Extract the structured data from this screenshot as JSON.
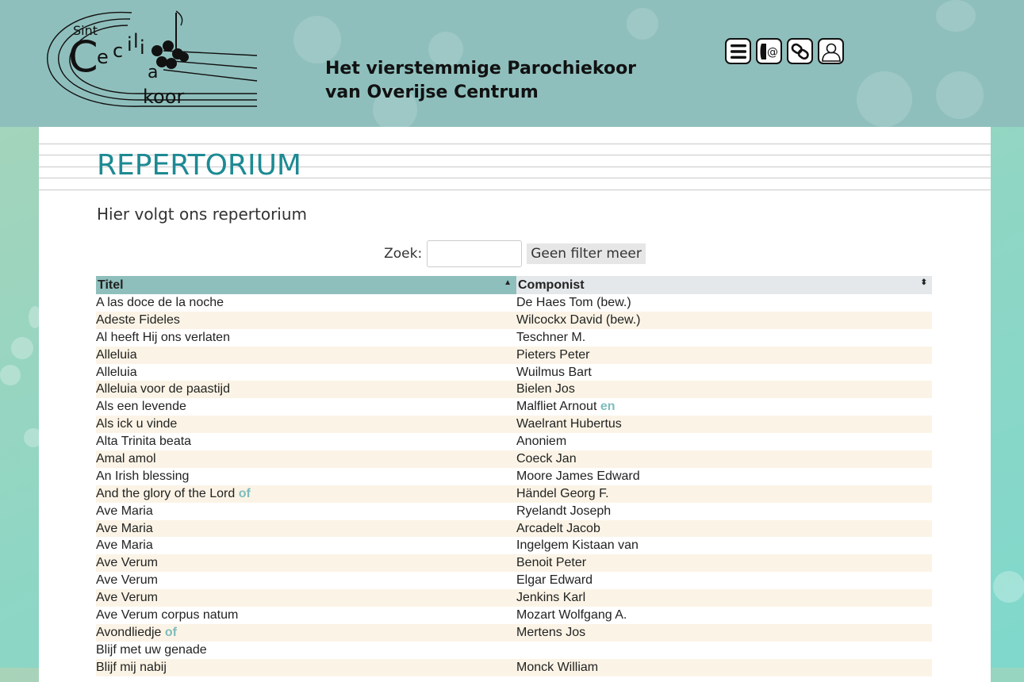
{
  "header": {
    "logo_alt": "Sint Cecilia koor",
    "tagline_line1": "Het vierstemmige Parochiekoor",
    "tagline_line2": "van Overijse Centrum",
    "icons": [
      "menu-icon",
      "contact-icon",
      "link-icon",
      "user-icon"
    ]
  },
  "page": {
    "title": "REPERTORIUM",
    "subtitle": "Hier volgt ons repertorium"
  },
  "search": {
    "label": "Zoek:",
    "value": "",
    "clear_label": "Geen filter meer"
  },
  "table": {
    "columns": [
      {
        "label": "Titel",
        "sort": "ascending"
      },
      {
        "label": "Componist",
        "sort": "none"
      }
    ],
    "rows": [
      {
        "title": "A las doce de la noche",
        "title_suffix": "",
        "composer": "De Haes Tom (bew.)",
        "composer_suffix": ""
      },
      {
        "title": "Adeste Fideles",
        "title_suffix": "",
        "composer": "Wilcockx David (bew.)",
        "composer_suffix": ""
      },
      {
        "title": "Al heeft Hij ons verlaten",
        "title_suffix": "",
        "composer": "Teschner M.",
        "composer_suffix": ""
      },
      {
        "title": "Alleluia",
        "title_suffix": "",
        "composer": "Pieters Peter",
        "composer_suffix": ""
      },
      {
        "title": "Alleluia",
        "title_suffix": "",
        "composer": "Wuilmus Bart",
        "composer_suffix": ""
      },
      {
        "title": "Alleluia voor de paastijd",
        "title_suffix": "",
        "composer": "Bielen Jos",
        "composer_suffix": ""
      },
      {
        "title": "Als een levende",
        "title_suffix": "",
        "composer": "Malfliet Arnout",
        "composer_suffix": "en"
      },
      {
        "title": "Als ick u vinde",
        "title_suffix": "",
        "composer": "Waelrant Hubertus",
        "composer_suffix": ""
      },
      {
        "title": "Alta Trinita beata",
        "title_suffix": "",
        "composer": "Anoniem",
        "composer_suffix": ""
      },
      {
        "title": "Amal amol",
        "title_suffix": "",
        "composer": "Coeck Jan",
        "composer_suffix": ""
      },
      {
        "title": "An Irish blessing",
        "title_suffix": "",
        "composer": "Moore James Edward",
        "composer_suffix": ""
      },
      {
        "title": "And the glory of the Lord",
        "title_suffix": "of",
        "composer": "Händel Georg F.",
        "composer_suffix": ""
      },
      {
        "title": "Ave Maria",
        "title_suffix": "",
        "composer": "Ryelandt Joseph",
        "composer_suffix": ""
      },
      {
        "title": "Ave Maria",
        "title_suffix": "",
        "composer": "Arcadelt Jacob",
        "composer_suffix": ""
      },
      {
        "title": "Ave Maria",
        "title_suffix": "",
        "composer": "Ingelgem Kistaan van",
        "composer_suffix": ""
      },
      {
        "title": "Ave Verum",
        "title_suffix": "",
        "composer": "Benoit Peter",
        "composer_suffix": ""
      },
      {
        "title": "Ave Verum",
        "title_suffix": "",
        "composer": "Elgar Edward",
        "composer_suffix": ""
      },
      {
        "title": "Ave Verum",
        "title_suffix": "",
        "composer": "Jenkins Karl",
        "composer_suffix": ""
      },
      {
        "title": "Ave Verum corpus natum",
        "title_suffix": "",
        "composer": "Mozart Wolfgang A.",
        "composer_suffix": ""
      },
      {
        "title": "Avondliedje",
        "title_suffix": "of",
        "composer": "Mertens Jos",
        "composer_suffix": ""
      },
      {
        "title": "Blijf met uw genade",
        "title_suffix": "",
        "composer": "",
        "composer_suffix": ""
      },
      {
        "title": "Blijf mij nabij",
        "title_suffix": "",
        "composer": "Monck William",
        "composer_suffix": ""
      }
    ]
  },
  "colors": {
    "header_bg": "#8fbfbc",
    "title": "#1d8a93",
    "row_alt": "#fbf4e6",
    "conjunction": "#7fbcbc"
  }
}
